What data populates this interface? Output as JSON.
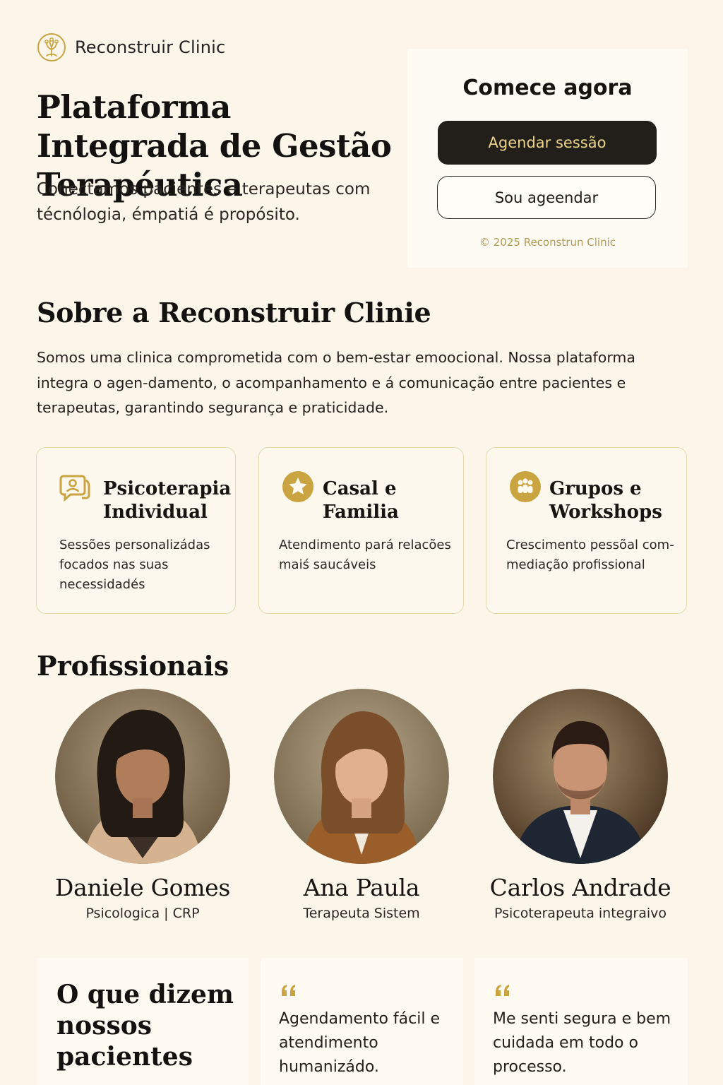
{
  "brand": {
    "name": "Reconstruir Clinic",
    "logo_icon": "tree-in-circle-icon",
    "accent_color": "#c9a441"
  },
  "hero": {
    "title": "Plataforma Integrada de Gestão Terapéutica",
    "subtitle": "Conectamos pacientes e terapeutas com técnólogia, émpatiá é propósito."
  },
  "cta": {
    "title": "Comece agora",
    "primary_button": "Agendar sessão",
    "secondary_button": "Sou ageendar",
    "copyright": "© 2025 Reconstrun Clinic"
  },
  "about": {
    "title": "Sobre a Reconstruir Clinie",
    "text": "Somos uma clinica comprometida com o bem-estar emoocional. Nossa plataforma integra o agen-damento, o acompanhamento e á comunicação entre pacientes e terapeutas, garantindo segurança e praticidade."
  },
  "services": [
    {
      "icon": "chat-bubble-icon",
      "title": "Psicoterapia Individual",
      "description": "Sessões personalizádas focados nas suas necessidadés"
    },
    {
      "icon": "star-icon",
      "title": "Casal e Familia",
      "description": "Atendimento pará relacões maiś saucáveis"
    },
    {
      "icon": "group-icon",
      "title": "Grupos e Workshops",
      "description": "Crescimento pessõal com-mediação profissional"
    }
  ],
  "professionals": {
    "title": "Profissionais",
    "items": [
      {
        "name": "Daniele Gomes",
        "role": "Psicologica | CRP"
      },
      {
        "name": "Ana Paula",
        "role": "Terapeuta Sistem"
      },
      {
        "name": "Carlos Andrade",
        "role": "Psicoterapeuta integraivo"
      }
    ]
  },
  "testimonials": {
    "title": "O que dizem nossos pacientes",
    "quote_icon": "quote-icon",
    "items": [
      {
        "text": "Agendamento fácil e atendimento humanizádo."
      },
      {
        "text": "Me senti segura e bem cuidada em todo o processo."
      }
    ]
  }
}
